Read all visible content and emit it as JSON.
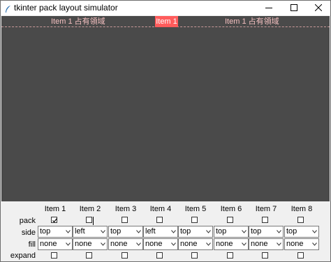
{
  "window": {
    "title": "tkinter pack layout simulator",
    "icons": {
      "app": "feather-icon",
      "minimize": "minimize-icon",
      "maximize": "maximize-icon",
      "close": "close-icon"
    }
  },
  "canvas": {
    "background": "#4a4a4a",
    "band_left_label": "Item 1 占有領域",
    "band_right_label": "Item 1 占有領域",
    "packed_item_label": "Item 1",
    "packed_item_color": "#ff5c5c"
  },
  "controls": {
    "row_labels": {
      "pack": "pack",
      "side": "side",
      "fill": "fill",
      "expand": "expand"
    },
    "items": [
      {
        "name": "Item 1",
        "pack": true,
        "side": "top",
        "fill": "none",
        "expand": false
      },
      {
        "name": "Item 2",
        "pack": false,
        "side": "left",
        "fill": "none",
        "expand": false
      },
      {
        "name": "Item 3",
        "pack": false,
        "side": "top",
        "fill": "none",
        "expand": false
      },
      {
        "name": "Item 4",
        "pack": false,
        "side": "left",
        "fill": "none",
        "expand": false
      },
      {
        "name": "Item 5",
        "pack": false,
        "side": "top",
        "fill": "none",
        "expand": false
      },
      {
        "name": "Item 6",
        "pack": false,
        "side": "top",
        "fill": "none",
        "expand": false
      },
      {
        "name": "Item 7",
        "pack": false,
        "side": "top",
        "fill": "none",
        "expand": false
      },
      {
        "name": "Item 8",
        "pack": false,
        "side": "top",
        "fill": "none",
        "expand": false
      }
    ]
  }
}
